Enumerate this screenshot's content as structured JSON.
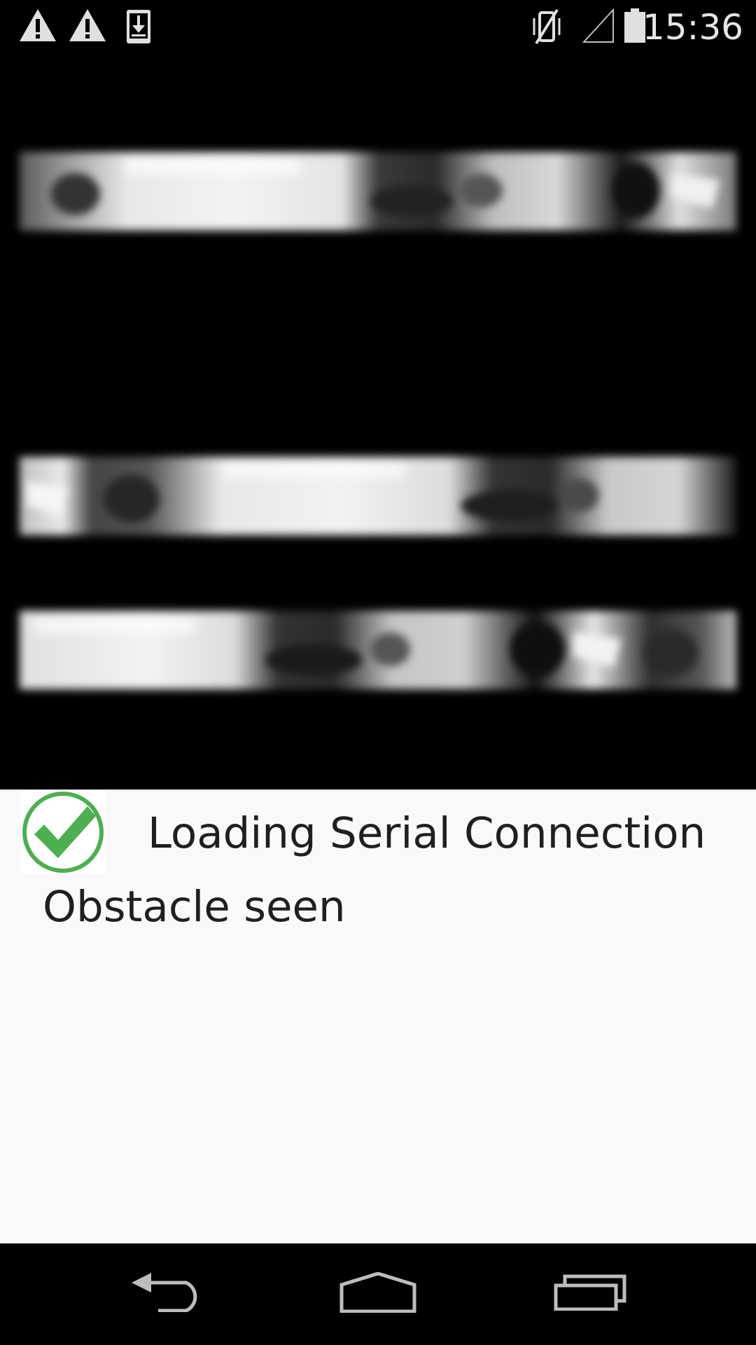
{
  "status_bar": {
    "time": "15:36",
    "left_icons": [
      "warning-icon",
      "warning-icon",
      "download-icon"
    ],
    "right_icons": [
      "vibrate-off-icon",
      "signal-icon",
      "battery-icon"
    ]
  },
  "info": {
    "status_message": "Loading Serial Connection",
    "detection_message": "Obstacle seen",
    "status_icon": "check-circle-icon",
    "status_color": "#4caf50"
  },
  "nav": {
    "buttons": [
      "back-icon",
      "home-icon",
      "recent-apps-icon"
    ]
  },
  "colors": {
    "panel_background": "#f9f9f9",
    "text": "#1f1f1f",
    "accent": "#4caf50"
  }
}
